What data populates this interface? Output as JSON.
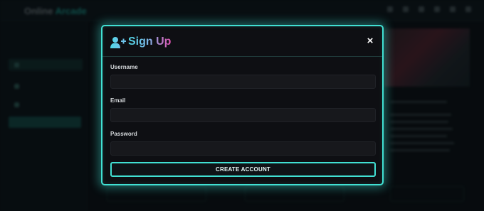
{
  "background": {
    "logo_main": "Online",
    "logo_accent": "Arcade"
  },
  "modal": {
    "title": "Sign Up",
    "close_glyph": "×",
    "user_icon": "user-plus-icon",
    "fields": [
      {
        "label": "Username",
        "value": "",
        "placeholder": ""
      },
      {
        "label": "Email",
        "value": "",
        "placeholder": ""
      },
      {
        "label": "Password",
        "value": "",
        "placeholder": ""
      }
    ],
    "submit_label": "CREATE ACCOUNT"
  },
  "colors": {
    "accent_cyan": "#41e0d3",
    "title_gradient_start": "#4fd8e6",
    "title_gradient_end": "#e253b3",
    "modal_bg": "#0e0f13",
    "input_bg": "#17181c"
  }
}
